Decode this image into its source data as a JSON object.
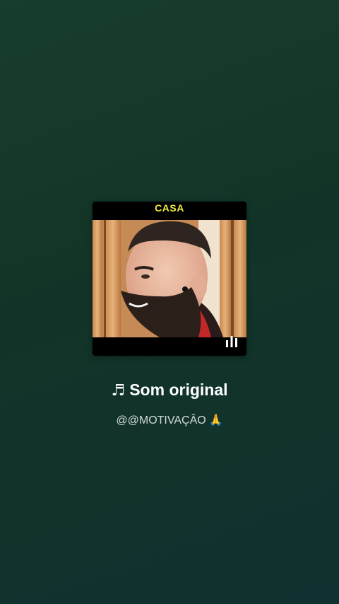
{
  "cover": {
    "caption": "CASA",
    "image": "man-with-beard-photo",
    "playing_indicator": "equalizer-icon"
  },
  "track": {
    "icon": "music-note-icon",
    "icon_glyph": "♬",
    "title": "Som original",
    "author": "@@MOTIVAÇÂO",
    "author_emoji": "🙏"
  },
  "colors": {
    "caption": "#f2ef3a",
    "background": "#14382c"
  }
}
